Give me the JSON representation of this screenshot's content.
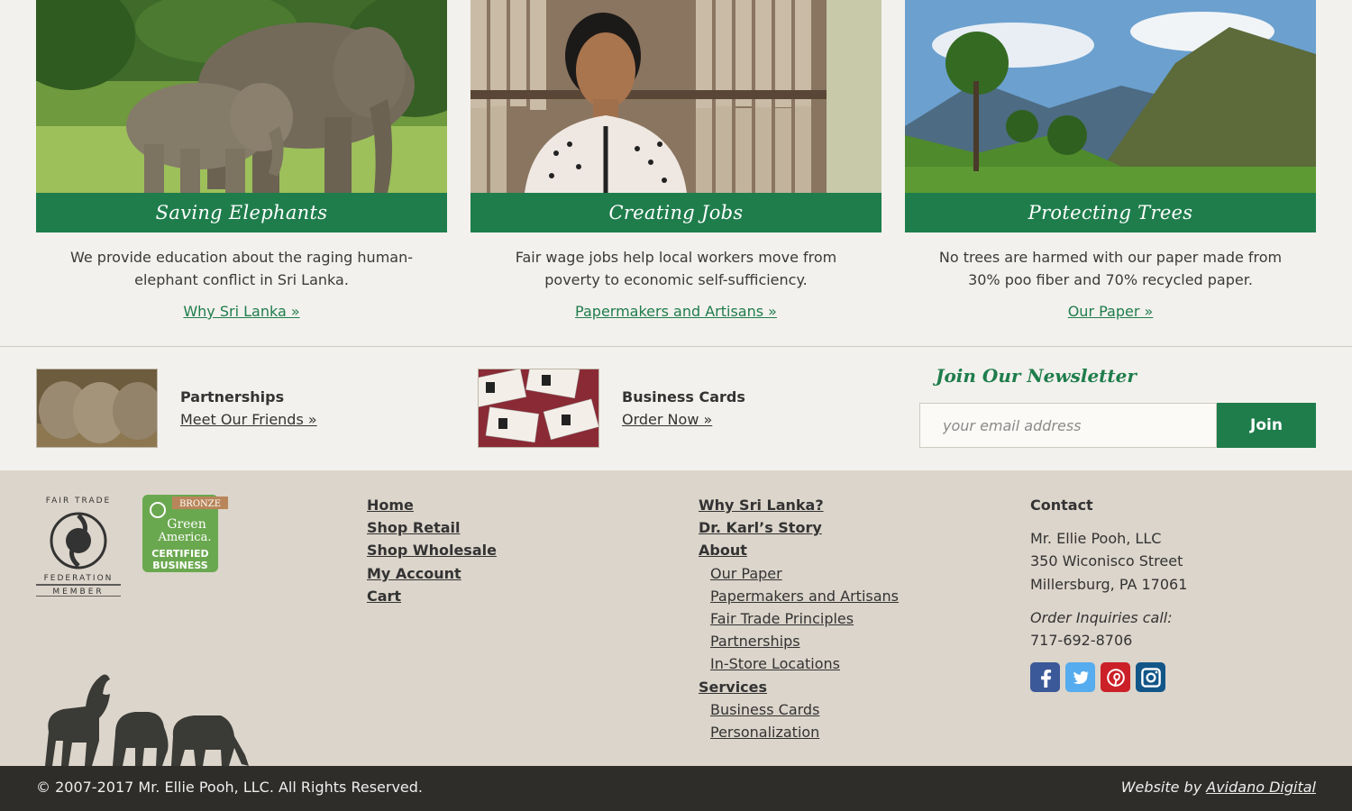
{
  "features": [
    {
      "title": "Saving Elephants",
      "description": "We provide education about the raging human-elephant conflict in Sri Lanka.",
      "link": "Why Sri Lanka »"
    },
    {
      "title": "Creating Jobs",
      "description": "Fair wage jobs help local workers move from poverty to economic self-sufficiency.",
      "link": "Papermakers and Artisans »"
    },
    {
      "title": "Protecting Trees",
      "description": "No trees are harmed with our paper made from 30% poo fiber and 70% recycled paper.",
      "link": "Our Paper »"
    }
  ],
  "promos": [
    {
      "title": "Partnerships",
      "link": "Meet Our Friends »"
    },
    {
      "title": "Business Cards",
      "link": "Order Now »"
    }
  ],
  "newsletter": {
    "heading": "Join Our Newsletter",
    "placeholder": "your email address",
    "button": "Join"
  },
  "badges": {
    "fair_trade": {
      "top": "FAIR TRADE",
      "bottom": "FEDERATION",
      "member": "MEMBER"
    },
    "green_america": {
      "tier": "BRONZE",
      "name1": "Green",
      "name2": "America.",
      "cert1": "CERTIFIED",
      "cert2": "BUSINESS"
    }
  },
  "footer": {
    "col1": [
      "Home",
      "Shop Retail",
      "Shop Wholesale",
      "My Account",
      "Cart"
    ],
    "col2": {
      "why": "Why Sri Lanka?",
      "story": "Dr. Karl’s Story",
      "about": "About",
      "about_items": [
        "Our Paper",
        "Papermakers and Artisans",
        "Fair Trade Principles",
        "Partnerships",
        "In-Store Locations"
      ],
      "services": "Services",
      "services_items": [
        "Business Cards",
        "Personalization"
      ]
    },
    "contact": {
      "heading": "Contact",
      "company": "Mr. Ellie Pooh, LLC",
      "street": "350 Wiconisco Street",
      "city": "Millersburg, PA 17061",
      "order_label": "Order Inquiries call:",
      "phone": "717-692-8706"
    },
    "social": [
      "facebook-icon",
      "twitter-icon",
      "pinterest-icon",
      "instagram-icon"
    ]
  },
  "bottom": {
    "copyright": "© 2007-2017 Mr. Ellie Pooh, LLC. All Rights Reserved.",
    "credit_prefix": "Website by",
    "credit_link": "Avidano Digital"
  },
  "colors": {
    "brand_green": "#1f7d4c",
    "footer_bg": "#dcd5cb",
    "bottom_bar": "#2e2d2a"
  }
}
